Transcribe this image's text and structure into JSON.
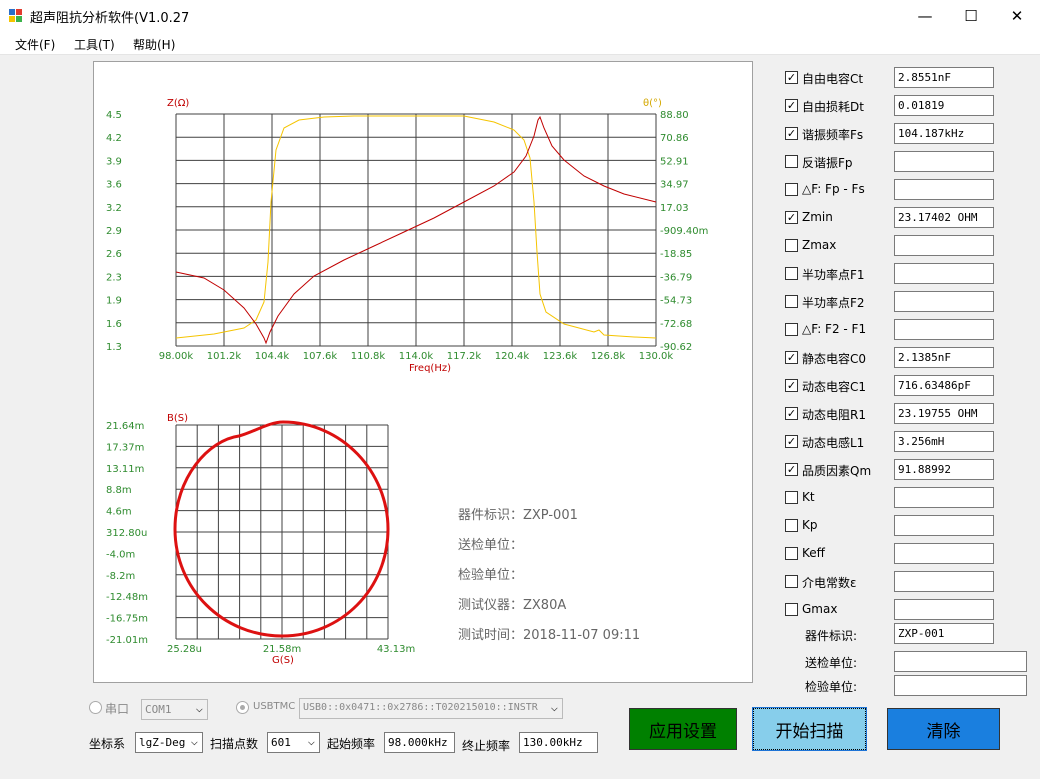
{
  "window": {
    "title": "超声阻抗分析软件(V1.0.27",
    "minimize": "—",
    "maximize": "☐",
    "close": "✕"
  },
  "menu": [
    "文件(F)",
    "工具(T)",
    "帮助(H)"
  ],
  "impedance_chart": {
    "left_axis_label": "Z(Ω)",
    "right_axis_label": "θ(°)",
    "x_axis_label": "Freq(Hz)",
    "left_ticks": [
      "4.5",
      "4.2",
      "3.9",
      "3.6",
      "3.2",
      "2.9",
      "2.6",
      "2.3",
      "1.9",
      "1.6",
      "1.3"
    ],
    "right_ticks": [
      "88.80",
      "70.86",
      "52.91",
      "34.97",
      "17.03",
      "-909.40m",
      "-18.85",
      "-36.79",
      "-54.73",
      "-72.68",
      "-90.62"
    ],
    "x_ticks": [
      "98.00k",
      "101.2k",
      "104.4k",
      "107.6k",
      "110.8k",
      "114.0k",
      "117.2k",
      "120.4k",
      "123.6k",
      "126.8k",
      "130.0k"
    ],
    "colors": {
      "impedance": "#c00000",
      "phase": "#f5c400",
      "tick_text": "#2e8b2e",
      "grid": "#404040"
    }
  },
  "admittance_chart": {
    "y_axis_label": "B(S)",
    "x_axis_label": "G(S)",
    "y_ticks": [
      "21.64m",
      "17.37m",
      "13.11m",
      "8.8m",
      "4.6m",
      "312.80u",
      "-4.0m",
      "-8.2m",
      "-12.48m",
      "-16.75m",
      "-21.01m"
    ],
    "x_ticks": [
      "25.28u",
      "21.58m",
      "43.13m"
    ],
    "circle_color": "#dd1111"
  },
  "device_info": {
    "device_id": "器件标识：ZXP-001",
    "submit_unit": "送检单位：",
    "inspect_unit": "检验单位：",
    "instrument": "测试仪器：ZX80A",
    "test_time": "测试时间：2018-11-07 09:11"
  },
  "parameters": [
    {
      "label": "自由电容Ct",
      "checked": true,
      "value": "2.8551nF"
    },
    {
      "label": "自由损耗Dt",
      "checked": true,
      "value": "0.01819"
    },
    {
      "label": "谐振频率Fs",
      "checked": true,
      "value": "104.187kHz"
    },
    {
      "label": "反谐振Fp",
      "checked": false,
      "value": ""
    },
    {
      "label": "△F: Fp - Fs",
      "checked": false,
      "value": ""
    },
    {
      "label": "Zmin",
      "checked": true,
      "value": "23.17402  OHM"
    },
    {
      "label": "Zmax",
      "checked": false,
      "value": ""
    },
    {
      "label": "半功率点F1",
      "checked": false,
      "value": ""
    },
    {
      "label": "半功率点F2",
      "checked": false,
      "value": ""
    },
    {
      "label": "△F: F2 - F1",
      "checked": false,
      "value": ""
    },
    {
      "label": "静态电容C0",
      "checked": true,
      "value": "2.1385nF"
    },
    {
      "label": "动态电容C1",
      "checked": true,
      "value": "716.63486pF"
    },
    {
      "label": "动态电阻R1",
      "checked": true,
      "value": "23.19755  OHM"
    },
    {
      "label": "动态电感L1",
      "checked": true,
      "value": "3.256mH"
    },
    {
      "label": "品质因素Qm",
      "checked": true,
      "value": "91.88992"
    },
    {
      "label": "Kt",
      "checked": false,
      "value": ""
    },
    {
      "label": "Kp",
      "checked": false,
      "value": ""
    },
    {
      "label": "Keff",
      "checked": false,
      "value": ""
    },
    {
      "label": "介电常数ε",
      "checked": false,
      "value": ""
    },
    {
      "label": "Gmax",
      "checked": false,
      "value": ""
    }
  ],
  "side_fields": {
    "device_id_label": "器件标识:",
    "device_id_value": "ZXP-001",
    "submit_unit_label": "送检单位:",
    "submit_unit_value": "",
    "inspect_unit_label": "检验单位:",
    "inspect_unit_value": ""
  },
  "connection": {
    "serial_label": "串口",
    "serial_port": "COM1",
    "usbtmc_label": "USBTMC",
    "usbtmc_address": "USB0::0x0471::0x2786::T020215010::INSTR"
  },
  "scan": {
    "coord_label": "坐标系",
    "coord_value": "lgZ-Deg",
    "points_label": "扫描点数",
    "points_value": "601",
    "start_label": "起始频率",
    "start_value": "98.000kHz",
    "stop_label": "终止频率",
    "stop_value": "130.00kHz"
  },
  "buttons": {
    "apply": "应用设置",
    "start": "开始扫描",
    "clear": "清除",
    "apply_color": "#008000",
    "start_color": "#87ceeb",
    "clear_color": "#1a7fdf"
  }
}
